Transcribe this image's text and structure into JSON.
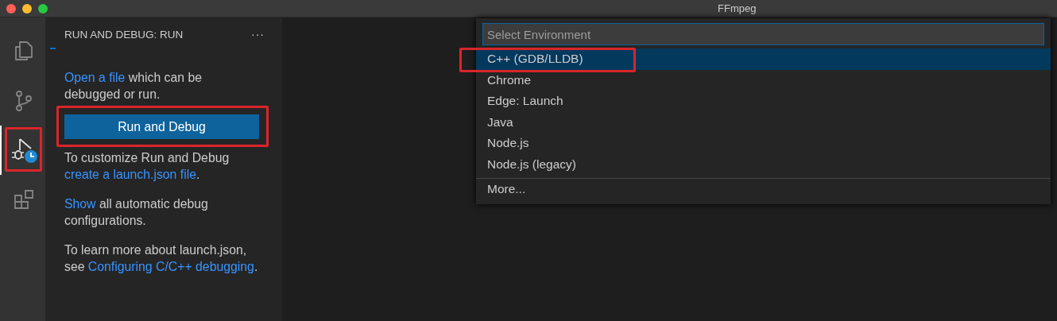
{
  "window": {
    "title": "FFmpeg"
  },
  "activity_bar": [
    {
      "kind": "files",
      "selected": false,
      "annotated": false
    },
    {
      "kind": "source-control",
      "selected": false,
      "annotated": false
    },
    {
      "kind": "run-debug",
      "selected": true,
      "annotated": true
    },
    {
      "kind": "extensions",
      "selected": false,
      "annotated": false
    }
  ],
  "sidebar": {
    "title": "RUN AND DEBUG: RUN",
    "more": "···",
    "intro": [
      {
        "text": "Open a file",
        "link": true
      },
      {
        "text": " which can be debugged or run.",
        "link": false
      }
    ],
    "button": {
      "label": "Run and Debug",
      "annotated": true
    },
    "paragraphs": [
      [
        {
          "text": "To customize Run and Debug ",
          "link": false
        },
        {
          "text": "create a launch.json file",
          "link": true
        },
        {
          "text": ".",
          "link": false
        }
      ],
      [
        {
          "text": "Show",
          "link": true
        },
        {
          "text": " all automatic debug configurations.",
          "link": false
        }
      ],
      [
        {
          "text": "To learn more about launch.json, see ",
          "link": false
        },
        {
          "text": "Configuring C/C++ debugging",
          "link": true
        },
        {
          "text": ".",
          "link": false
        }
      ]
    ]
  },
  "quick_pick": {
    "placeholder": "Select Environment",
    "items": [
      {
        "label": "C++ (GDB/LLDB)",
        "selected": true,
        "annotated": true
      },
      {
        "label": "Chrome",
        "selected": false,
        "annotated": false
      },
      {
        "label": "Edge: Launch",
        "selected": false,
        "annotated": false
      },
      {
        "label": "Java",
        "selected": false,
        "annotated": false
      },
      {
        "label": "Node.js",
        "selected": false,
        "annotated": false
      },
      {
        "label": "Node.js (legacy)",
        "selected": false,
        "annotated": false
      }
    ],
    "more": "More..."
  }
}
